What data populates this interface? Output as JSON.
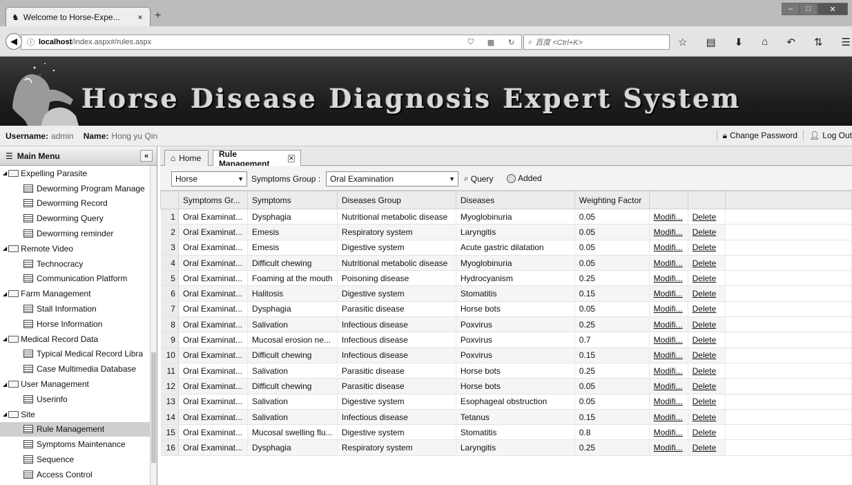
{
  "browser": {
    "tab_title": "Welcome to Horse-Expe...",
    "url_host": "localhost",
    "url_path": "/index.aspx#/rules.aspx",
    "search_placeholder": "百度 <Ctrl+K>"
  },
  "app": {
    "title": "Horse Disease Diagnosis Expert System",
    "username_label": "Username:",
    "username_value": "admin",
    "name_label": "Name:",
    "name_value": "Hong yu Qin",
    "change_password": "Change Password",
    "log_out": "Log Out"
  },
  "sidebar": {
    "title": "Main Menu",
    "groups": [
      {
        "label": "Expelling Parasite",
        "items": [
          "Deworming Program Manage",
          "Deworming Record",
          "Deworming Query",
          "Deworming reminder"
        ]
      },
      {
        "label": "Remote Video",
        "items": [
          "Technocracy",
          "Communication Platform"
        ]
      },
      {
        "label": "Farm Management",
        "items": [
          "Stall Information",
          "Horse Information"
        ]
      },
      {
        "label": "Medical Record Data",
        "items": [
          "Typical Medical Record Libra",
          "Case Multimedia Database"
        ]
      },
      {
        "label": "User Management",
        "items": [
          "Userinfo"
        ]
      },
      {
        "label": "Site",
        "items": [
          "Rule Management",
          "Symptoms Maintenance",
          "Sequence",
          "Access Control"
        ]
      }
    ],
    "active_item": "Rule Management"
  },
  "tabs": {
    "home": "Home",
    "rule": "Rule Management"
  },
  "toolbar": {
    "animal_value": "Horse",
    "symptoms_group_label": "Symptoms Group :",
    "symptoms_group_value": "Oral Examination",
    "query_label": "Query",
    "added_label": "Added"
  },
  "table": {
    "columns": [
      "Symptoms Gr...",
      "Symptoms",
      "Diseases Group",
      "Diseases",
      "Weighting Factor",
      "",
      ""
    ],
    "modify_label": "Modifi...",
    "delete_label": "Delete",
    "rows": [
      [
        "1",
        "Oral Examinat...",
        "Dysphagia",
        "Nutritional metabolic disease",
        "Myoglobinuria",
        "0.05"
      ],
      [
        "2",
        "Oral Examinat...",
        "Emesis",
        "Respiratory system",
        "Laryngitis",
        "0.05"
      ],
      [
        "3",
        "Oral Examinat...",
        "Emesis",
        "Digestive system",
        "Acute gastric dilatation",
        "0.05"
      ],
      [
        "4",
        "Oral Examinat...",
        "Difficult chewing",
        "Nutritional metabolic disease",
        "Myoglobinuria",
        "0.05"
      ],
      [
        "5",
        "Oral Examinat...",
        "Foaming at the mouth",
        "Poisoning disease",
        "Hydrocyanism",
        "0.25"
      ],
      [
        "6",
        "Oral Examinat...",
        "Halitosis",
        "Digestive system",
        "Stomatitis",
        "0.15"
      ],
      [
        "7",
        "Oral Examinat...",
        "Dysphagia",
        "Parasitic disease",
        "Horse bots",
        "0.05"
      ],
      [
        "8",
        "Oral Examinat...",
        "Salivation",
        "Infectious disease",
        "Poxvirus",
        "0.25"
      ],
      [
        "9",
        "Oral Examinat...",
        "Mucosal erosion ne...",
        "Infectious disease",
        "Poxvirus",
        "0.7"
      ],
      [
        "10",
        "Oral Examinat...",
        "Difficult chewing",
        "Infectious disease",
        "Poxvirus",
        "0.15"
      ],
      [
        "11",
        "Oral Examinat...",
        "Salivation",
        "Parasitic disease",
        "Horse bots",
        "0.25"
      ],
      [
        "12",
        "Oral Examinat...",
        "Difficult chewing",
        "Parasitic disease",
        "Horse bots",
        "0.05"
      ],
      [
        "13",
        "Oral Examinat...",
        "Salivation",
        "Digestive system",
        "Esophageal obstruction",
        "0.05"
      ],
      [
        "14",
        "Oral Examinat...",
        "Salivation",
        "Infectious disease",
        "Tetanus",
        "0.15"
      ],
      [
        "15",
        "Oral Examinat...",
        "Mucosal swelling flu...",
        "Digestive system",
        "Stomatitis",
        "0.8"
      ],
      [
        "16",
        "Oral Examinat...",
        "Dysphagia",
        "Respiratory system",
        "Laryngitis",
        "0.25"
      ]
    ]
  },
  "icons": [
    "horse-icon",
    "info-icon",
    "star-icon",
    "home-icon",
    "query-icon",
    "added-icon",
    "folder-icon",
    "page-icon",
    "lock-icon",
    "user-icon"
  ],
  "colors": {
    "banner": "#1c1c1c",
    "selected": "#cfcfcf"
  }
}
